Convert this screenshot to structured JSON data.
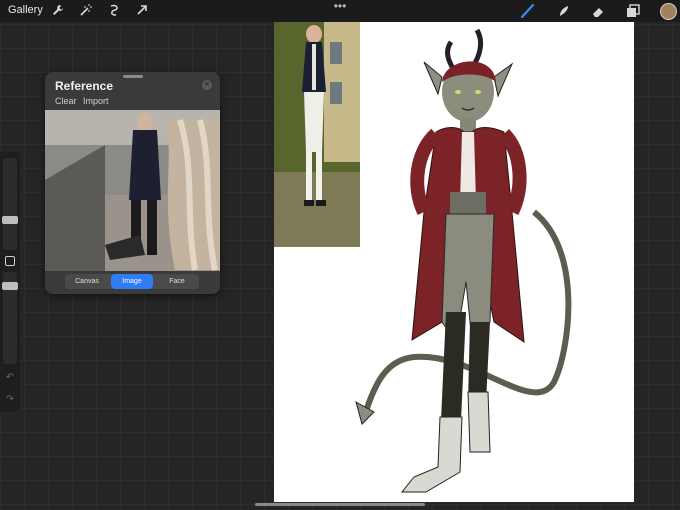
{
  "toolbar": {
    "gallery_label": "Gallery",
    "left_icons": [
      "wrench-icon",
      "magic-wand-icon",
      "selection-icon",
      "transform-arrow-icon"
    ],
    "right_icons": [
      "brush-icon",
      "smudge-icon",
      "eraser-icon",
      "layers-icon"
    ],
    "active_tool": "brush-icon",
    "current_color": "#a0825c",
    "accent": "#2f7cf6"
  },
  "reference": {
    "title": "Reference",
    "clear_label": "Clear",
    "import_label": "Import",
    "segments": [
      "Canvas",
      "Image",
      "Face"
    ],
    "active_segment": "Image"
  }
}
